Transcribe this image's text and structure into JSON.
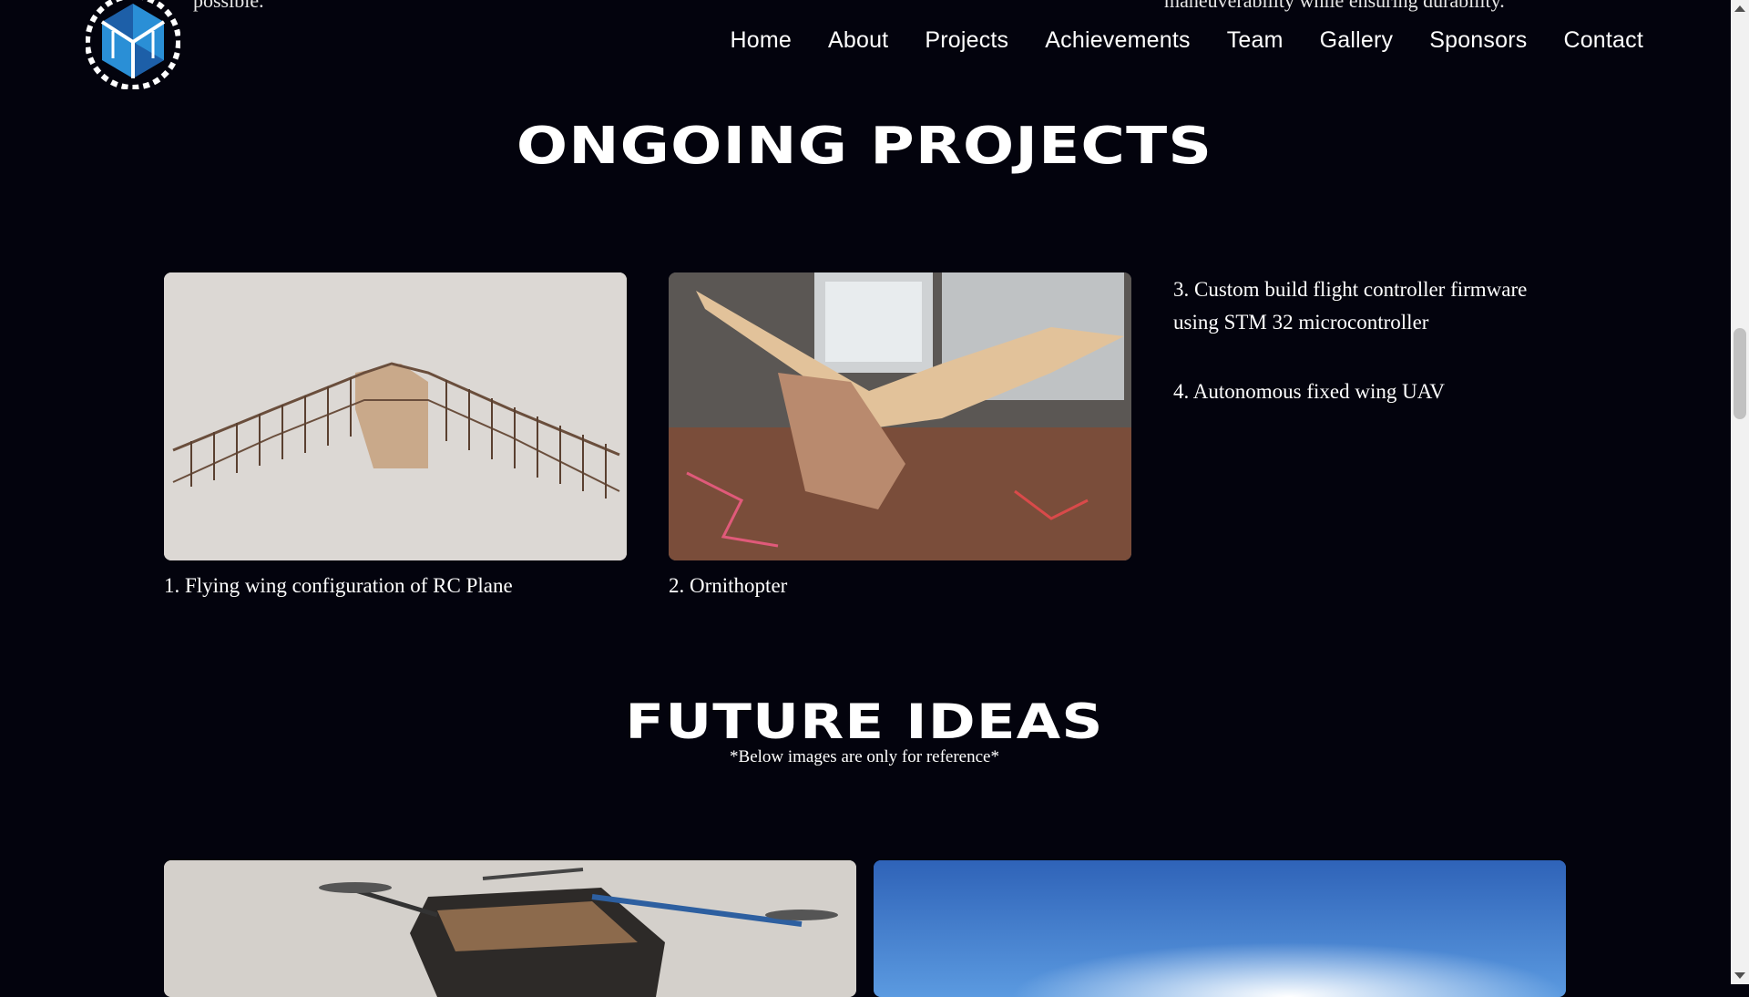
{
  "header": {
    "clipped_left": "possible.",
    "clipped_right": "maneuverability while ensuring durability.",
    "nav": [
      "Home",
      "About",
      "Projects",
      "Achievements",
      "Team",
      "Gallery",
      "Sponsors",
      "Contact"
    ]
  },
  "ongoing": {
    "title": "ONGOING PROJECTS",
    "projects": [
      "1. Flying wing configuration of RC Plane",
      "2. Ornithopter",
      "3. Custom build flight controller firmware using STM 32 microcontroller",
      "4. Autonomous fixed wing UAV"
    ]
  },
  "future": {
    "title": "FUTURE IDEAS",
    "note": "*Below images are only for reference*"
  },
  "colors": {
    "background": "#03030d",
    "logo_blue": "#2a8fd6",
    "logo_dark_blue": "#1d5fa8"
  }
}
